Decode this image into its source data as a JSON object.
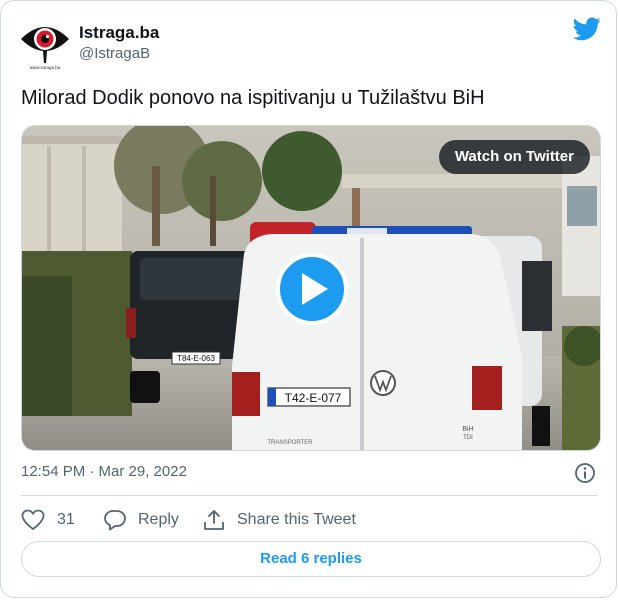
{
  "tweet": {
    "author_name": "Istraga.ba",
    "author_handle": "@IstragaB",
    "avatar_caption": "www.istraga.ba",
    "text": "Milorad Dodik ponovo na ispitivanju u Tužilaštvu BiH",
    "timestamp": "12:54 PM · Mar 29, 2022"
  },
  "media": {
    "watch_label": "Watch on Twitter",
    "plate_front": "T42-E-077",
    "plate_pickup": "T84-E-063",
    "van_badge": "TRANSPORTER",
    "van_trim": "TDI",
    "van_bih": "BiH"
  },
  "actions": {
    "like_count": "31",
    "reply_label": "Reply",
    "share_label": "Share this Tweet"
  },
  "footer": {
    "read_replies_label": "Read 6 replies"
  },
  "colors": {
    "twitter_blue": "#1d9bf0",
    "text_primary": "#0f1419",
    "text_secondary": "#536471",
    "border": "#cfd9de"
  }
}
